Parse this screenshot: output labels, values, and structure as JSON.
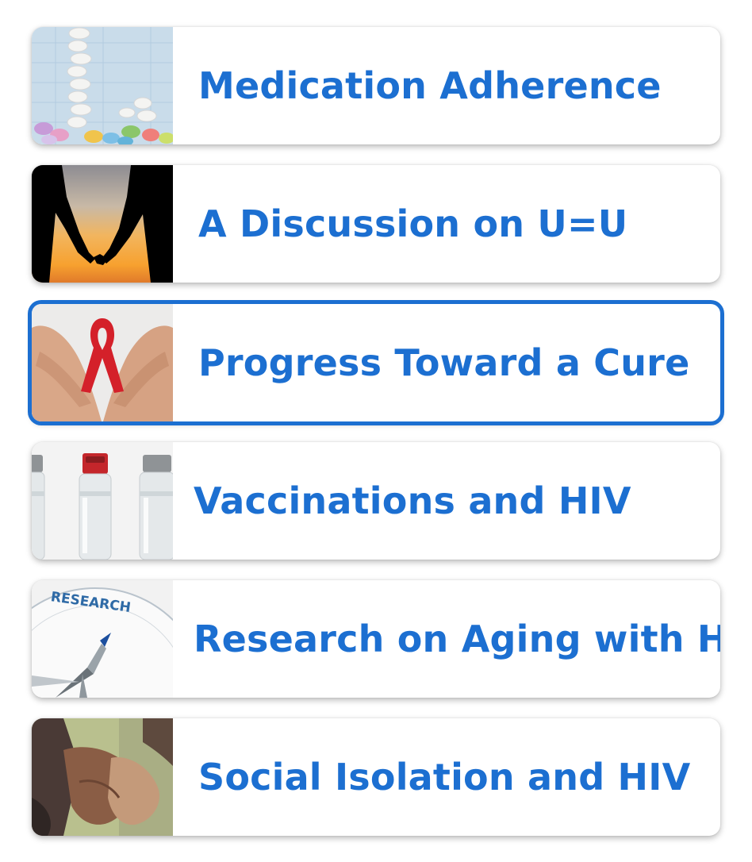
{
  "topics": [
    {
      "label": "Medication Adherence",
      "thumbnail": "pills-image",
      "selected": false
    },
    {
      "label": "A Discussion on U=U",
      "thumbnail": "couple-silhouette-image",
      "selected": false
    },
    {
      "label": "Progress Toward a Cure",
      "thumbnail": "red-ribbon-hands-image",
      "selected": true
    },
    {
      "label": "Vaccinations and HIV",
      "thumbnail": "vaccine-vials-image",
      "selected": false
    },
    {
      "label": "Research on Aging with HIV",
      "thumbnail": "research-compass-image",
      "thumbnail_text": "RESEARCH",
      "selected": false
    },
    {
      "label": "Social Isolation and HIV",
      "thumbnail": "holding-hands-image",
      "selected": false
    }
  ],
  "colors": {
    "accent": "#1c6fd1",
    "card_background": "#ffffff",
    "selected_border": "#1c6fd1"
  }
}
